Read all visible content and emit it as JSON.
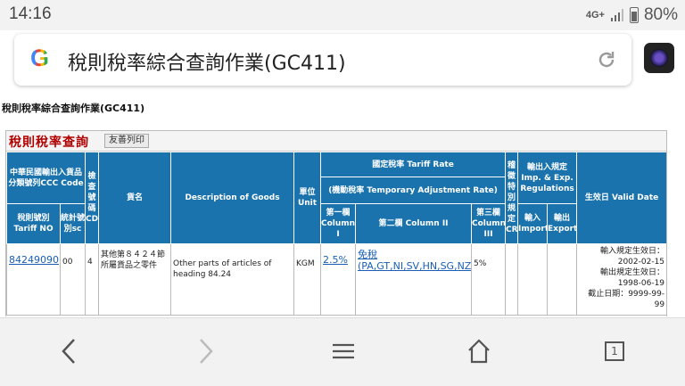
{
  "status_bar": {
    "time": "14:16",
    "network": "4G+",
    "battery": "80%"
  },
  "address_bar": {
    "query": "稅則稅率綜合查詢作業(GC411)"
  },
  "page": {
    "title": "稅則稅率綜合查詢作業(GC411)",
    "panel_title": "稅則稅率查詢",
    "print_label": "友善列印"
  },
  "table": {
    "h_ccc": "中華民國輸出入貨品分類號列CCC Code",
    "h_cd": "檢查號碼CD",
    "h_name_zh": "貨名",
    "h_desc": "Description of Goods",
    "h_unit": "單位Unit",
    "h_rate": "國定稅率 Tariff Rate",
    "h_temp": "(機動稅率 Temporary Adjustment Rate)",
    "h_col1": "第一欄Column I",
    "h_col2": "第二欄 Column II",
    "h_col3": "第三欄Column III",
    "h_cr": "稽徵特別規定CR",
    "h_reg": "輸出入規定 Imp. & Exp. Regulations",
    "h_import": "輸入Import",
    "h_export": "輸出Export",
    "h_valid": "生效日 Valid Date",
    "h_tariff_no": "稅則號別 Tariff NO",
    "h_sc": "統計號別sc",
    "row": {
      "tariff_no": "84249090",
      "sc": "00",
      "cd": "4",
      "name_zh": "其他第８４２４節所屬貨品之零件",
      "desc": "Other parts of articles of heading 84.24",
      "unit": "KGM",
      "col1": "2.5%",
      "col2": "免稅 (PA,GT,NI,SV,HN,SG,NZ)",
      "col3": "5%",
      "valid_import_label": "輸入規定生效日：",
      "valid_import_date": "2002-02-15",
      "valid_export_label": "輸出規定生效日：",
      "valid_export_date": "1998-06-19",
      "valid_end": "截止日期：9999-99-99"
    }
  },
  "nav": {
    "tab_count": "1"
  }
}
